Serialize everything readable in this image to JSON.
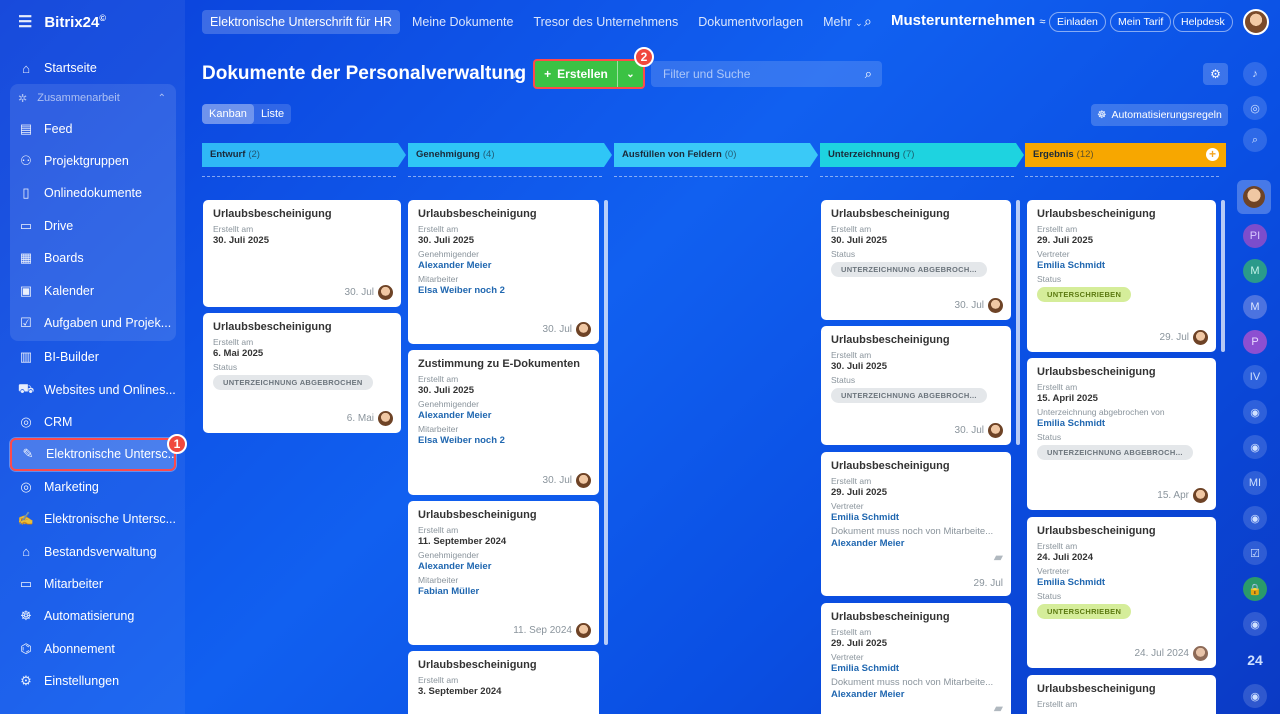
{
  "app": {
    "name": "Bitrix24",
    "mark": "©"
  },
  "header": {
    "tabs": [
      "Elektronische Unterschrift für HR",
      "Meine Dokumente",
      "Tresor des Unternehmens",
      "Dokumentvorlagen",
      "Mehr"
    ],
    "company": "Musterunternehmen",
    "buttons": [
      "Einladen",
      "Mein Tarif",
      "Helpdesk"
    ]
  },
  "sidebar": {
    "items": [
      {
        "label": "Startseite",
        "icon": "home-icon"
      },
      {
        "label": "Zusammenarbeit",
        "icon": "collab-icon"
      },
      {
        "label": "Feed",
        "icon": "feed-icon"
      },
      {
        "label": "Projektgruppen",
        "icon": "groups-icon"
      },
      {
        "label": "Onlinedokumente",
        "icon": "document-icon"
      },
      {
        "label": "Drive",
        "icon": "drive-icon"
      },
      {
        "label": "Boards",
        "icon": "boards-icon"
      },
      {
        "label": "Kalender",
        "icon": "calendar-icon"
      },
      {
        "label": "Aufgaben und Projek...",
        "icon": "tasks-icon"
      },
      {
        "label": "BI-Builder",
        "icon": "chart-icon"
      },
      {
        "label": "Websites und Onlines...",
        "icon": "cart-icon"
      },
      {
        "label": "CRM",
        "icon": "crm-icon"
      },
      {
        "label": "Elektronische Untersc...",
        "icon": "signature-icon"
      },
      {
        "label": "Marketing",
        "icon": "target-icon"
      },
      {
        "label": "Elektronische Untersc...",
        "icon": "pen-icon"
      },
      {
        "label": "Bestandsverwaltung",
        "icon": "warehouse-icon"
      },
      {
        "label": "Mitarbeiter",
        "icon": "employees-icon"
      },
      {
        "label": "Automatisierung",
        "icon": "robot-icon"
      },
      {
        "label": "Abonnement",
        "icon": "subscription-icon"
      },
      {
        "label": "Einstellungen",
        "icon": "settings-icon"
      }
    ],
    "callout_1": "1"
  },
  "toolbar": {
    "title": "Dokumente der Personalverwaltung",
    "create_label": "Erstellen",
    "callout_2": "2",
    "filter_placeholder": "Filter und Suche",
    "views": [
      "Kanban",
      "Liste"
    ],
    "automation_label": "Automatisierungsregeln"
  },
  "columns": [
    {
      "name": "Entwurf",
      "count": "(2)",
      "color": "#2fc6f6"
    },
    {
      "name": "Genehmigung",
      "count": "(4)",
      "color": "#2fc6f6"
    },
    {
      "name": "Ausfüllen von Feldern",
      "count": "(0)",
      "color": "#2fc6f6"
    },
    {
      "name": "Unterzeichnung",
      "count": "(7)",
      "color": "#1ed3e0"
    },
    {
      "name": "Ergebnis",
      "count": "(12)",
      "color": "#f7a700"
    }
  ],
  "labels": {
    "created": "Erstellt am",
    "approver": "Genehmigender",
    "employee": "Mitarbeiter",
    "status": "Status",
    "representative": "Vertreter",
    "cancelled_by": "Unterzeichnung abgebrochen von",
    "pending_note": "Dokument muss noch von Mitarbeite..."
  },
  "cards": {
    "c1": {
      "title": "Urlaubsbescheinigung",
      "date": "30. Juli 2025",
      "foot": "30. Jul"
    },
    "c2": {
      "title": "Urlaubsbescheinigung",
      "date": "6. Mai 2025",
      "status": "UNTERZEICHNUNG ABGEBROCHEN",
      "foot": "6. Mai"
    },
    "g1": {
      "title": "Urlaubsbescheinigung",
      "date": "30. Juli 2025",
      "approver": "Alexander Meier",
      "employee": "Elsa Weiber noch 2",
      "foot": "30. Jul"
    },
    "g2": {
      "title": "Zustimmung zu E-Dokumenten",
      "date": "30. Juli 2025",
      "approver": "Alexander Meier",
      "employee": "Elsa Weiber noch 2",
      "foot": "30. Jul"
    },
    "g3": {
      "title": "Urlaubsbescheinigung",
      "date": "11. September 2024",
      "approver": "Alexander Meier",
      "employee": "Fabian Müller",
      "foot": "11. Sep 2024"
    },
    "g4": {
      "title": "Urlaubsbescheinigung",
      "date": "3. September 2024"
    },
    "u1": {
      "title": "Urlaubsbescheinigung",
      "date": "30. Juli 2025",
      "status": "UNTERZEICHNUNG ABGEBROCH...",
      "foot": "30. Jul"
    },
    "u2": {
      "title": "Urlaubsbescheinigung",
      "date": "30. Juli 2025",
      "status": "UNTERZEICHNUNG ABGEBROCH...",
      "foot": "30. Jul"
    },
    "u3": {
      "title": "Urlaubsbescheinigung",
      "date": "29. Juli 2025",
      "rep": "Emilia Schmidt",
      "signer": "Alexander Meier",
      "foot": "29. Jul"
    },
    "u4": {
      "title": "Urlaubsbescheinigung",
      "date": "29. Juli 2025",
      "rep": "Emilia Schmidt",
      "signer": "Alexander Meier"
    },
    "e1": {
      "title": "Urlaubsbescheinigung",
      "date": "29. Juli 2025",
      "rep": "Emilia Schmidt",
      "status": "UNTERSCHRIEBEN",
      "foot": "29. Jul"
    },
    "e2": {
      "title": "Urlaubsbescheinigung",
      "date": "15. April 2025",
      "by": "Emilia Schmidt",
      "status": "UNTERZEICHNUNG ABGEBROCH...",
      "foot": "15. Apr"
    },
    "e3": {
      "title": "Urlaubsbescheinigung",
      "date": "24. Juli 2024",
      "rep": "Emilia Schmidt",
      "status": "UNTERSCHRIEBEN",
      "foot": "24. Jul 2024"
    },
    "e4": {
      "title": "Urlaubsbescheinigung"
    }
  },
  "right_rail": {
    "initials": [
      "PI",
      "M",
      "M",
      "P",
      "IV",
      "MI"
    ],
    "counter": "24"
  }
}
